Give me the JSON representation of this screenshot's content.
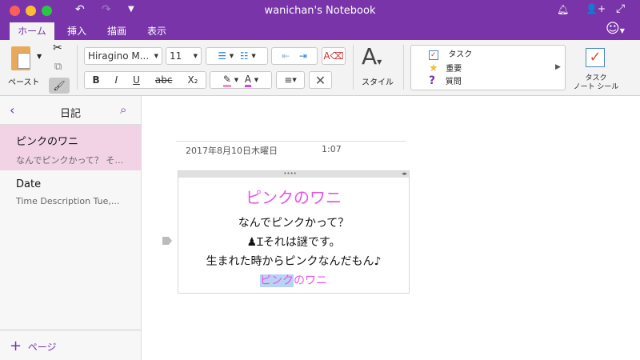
{
  "window": {
    "title": "wanichan's Notebook"
  },
  "titlebar": {
    "undo_icon": "undo-icon",
    "redo_icon": "redo-icon",
    "customize_icon": "chevron-down-icon",
    "bell_icon": "bell-icon",
    "share_icon": "add-person-icon",
    "fullscreen_icon": "expand-icon",
    "feedback_icon": "smiley-icon"
  },
  "tabs": [
    {
      "label": "ホーム",
      "active": true
    },
    {
      "label": "挿入"
    },
    {
      "label": "描画"
    },
    {
      "label": "表示"
    }
  ],
  "ribbon": {
    "paste_label": "ペースト",
    "font_name": "Hiragino M...",
    "font_size": "11",
    "bold": "B",
    "italic": "I",
    "underline": "U",
    "strike": "abc",
    "subscript": "X₂",
    "highlight_color": "#f08cc8",
    "font_color": "#e040e0",
    "style_label": "スタイル",
    "tags": [
      {
        "label": "タスク",
        "icon": "checkbox-icon"
      },
      {
        "label": "重要",
        "icon": "star-icon"
      },
      {
        "label": "質問",
        "icon": "question-icon"
      }
    ],
    "task_tag_label_1": "タスク",
    "task_tag_label_2": "ノート シール"
  },
  "sidebar": {
    "section_title": "日記",
    "pages": [
      {
        "title": "ピンクのワニ",
        "preview": "なんでピンクかって？ そ…",
        "selected": true
      },
      {
        "title": "Date",
        "preview": "Time  Description  Tue,..."
      }
    ],
    "add_page_label": "ページ"
  },
  "page": {
    "date": "2017年8月10日木曜日",
    "time": "1:07",
    "note": {
      "title": "ピンクのワニ",
      "line1": "なんでピンクかって？",
      "line2": "それは謎です。",
      "line3": "生まれた時からピンクなんだもん♪",
      "line4_selected": "ピンク",
      "line4_rest": "のワニ"
    }
  },
  "colors": {
    "accent": "#7834a8",
    "selected_page": "#f2d3e6",
    "pink_text": "#e455e8",
    "selection": "#b8d4f5"
  }
}
